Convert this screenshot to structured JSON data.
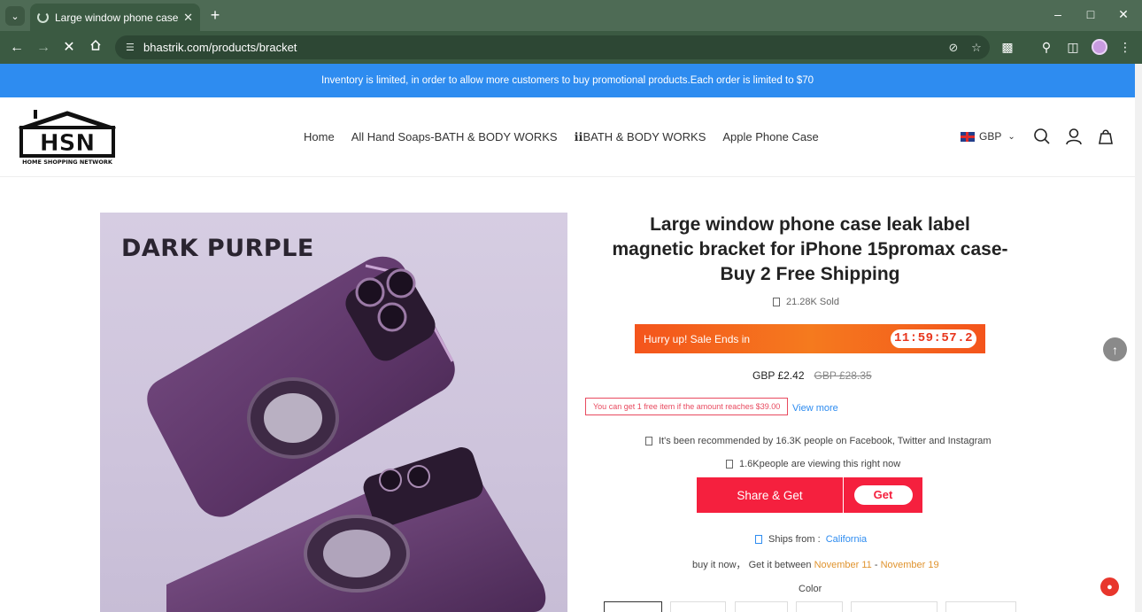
{
  "browser": {
    "tab_title": "Large window phone case leak",
    "url": "bhastrik.com/products/bracket",
    "icons": {
      "tab_list": "chevron-down-icon",
      "tab_loading": "spinner-icon",
      "tab_close": "close-icon",
      "new_tab": "plus-icon",
      "back": "arrow-left-icon",
      "forward": "arrow-right-icon",
      "stop": "close-icon",
      "home": "home-icon",
      "site_settings": "tune-icon",
      "eye_off": "eye-off-icon",
      "bookmark": "star-icon",
      "extensions": "puzzle-icon",
      "labs": "flask-icon",
      "side_panel": "side-panel-icon",
      "menu": "kebab-menu-icon",
      "minimize": "minimize-icon",
      "maximize": "maximize-icon",
      "close_window": "close-icon"
    }
  },
  "announcement": "Inventory is limited, in order to allow more customers to buy promotional products.Each order is limited to $70",
  "header": {
    "logo_text": "HSN",
    "logo_subtext": "HOME SHOPPING NETWORK",
    "nav": [
      "Home",
      "All Hand Soaps-BATH & BODY WORKS",
      "ℹℹBATH & BODY WORKS",
      "Apple Phone Case"
    ],
    "currency": "GBP"
  },
  "product": {
    "image_label": "DARK PURPLE",
    "title": "Large window phone case leak label magnetic bracket for iPhone 15promax case-Buy 2 Free Shipping",
    "sold": "21.28K Sold",
    "sale_text": "Hurry up! Sale Ends in",
    "timer": "11:59:57.2",
    "price": "GBP £2.42",
    "compare_price": "GBP £28.35",
    "free_item_tag": "You can get 1 free item if the amount reaches $39.00",
    "view_more": "View more",
    "recommended": "It's been recommended by 16.3K people on Facebook, Twitter and Instagram",
    "viewing": "1.6Kpeople are viewing this right now",
    "share_button": "Share & Get",
    "get_button": "Get",
    "ships_from_label": "Ships from :",
    "ships_from": "California",
    "delivery_prefix": "buy it now， Get it between",
    "delivery_start": "November 11",
    "delivery_sep": "-",
    "delivery_end": "November 19",
    "color_label": "Color"
  },
  "colors": {
    "announcement_bg": "#2e8cf0",
    "sale_orange": "#f4541c",
    "share_red": "#f5203e",
    "link_blue": "#2e8cf0",
    "date_orange": "#e0942f",
    "browser_green": "#3b5a42"
  }
}
